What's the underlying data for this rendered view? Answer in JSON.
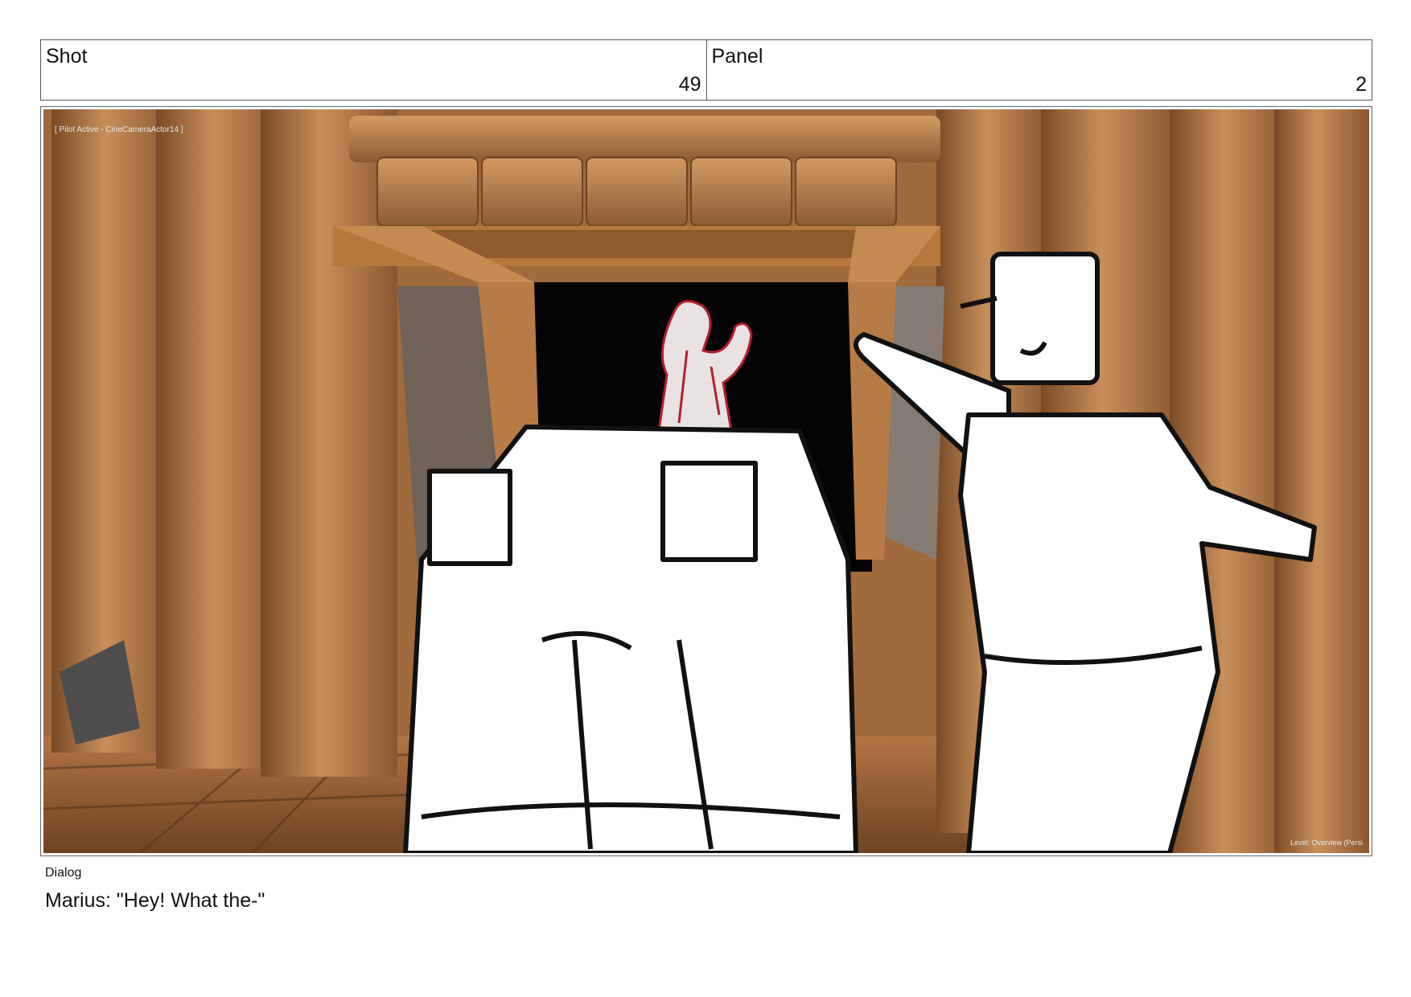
{
  "header": {
    "shot_label": "Shot",
    "shot_number": "49",
    "panel_label": "Panel",
    "panel_number": "2"
  },
  "frame": {
    "overlay_tag": "[ Pilot Active - CineCameraActor14 ]",
    "corner_tag": "Level: Overview (Persi"
  },
  "dialog": {
    "label": "Dialog",
    "text": "Marius: \"Hey! What the-\""
  }
}
